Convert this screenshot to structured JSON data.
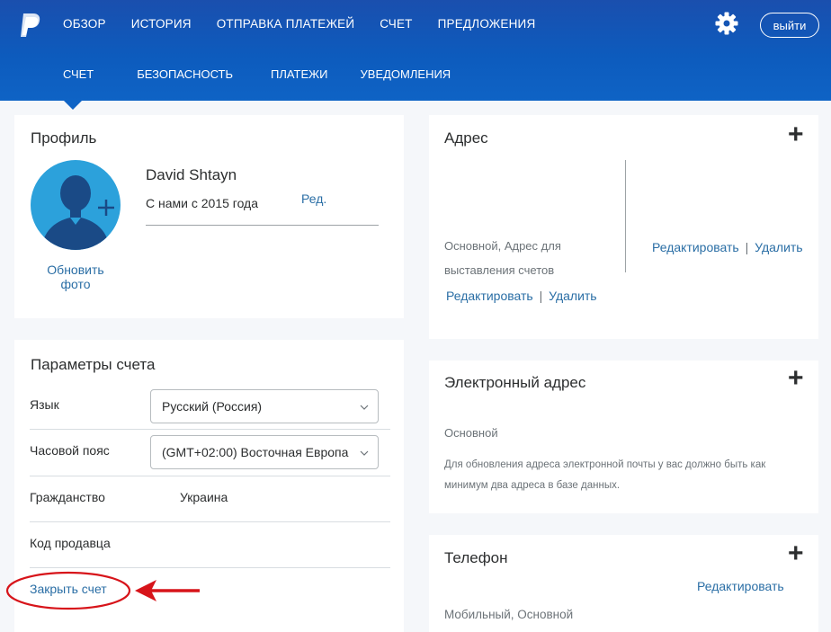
{
  "header": {
    "nav_main": [
      "ОБЗОР",
      "ИСТОРИЯ",
      "ОТПРАВКА ПЛАТЕЖЕЙ",
      "СЧЕТ",
      "ПРЕДЛОЖЕНИЯ"
    ],
    "nav_sub": [
      "СЧЕТ",
      "БЕЗОПАСНОСТЬ",
      "ПЛАТЕЖИ",
      "УВЕДОМЛЕНИЯ"
    ],
    "logout_label": "выйти",
    "icons": [
      "paypal-logo-icon",
      "gear-icon"
    ],
    "brand_color": "#0e63c5"
  },
  "profile": {
    "title": "Профиль",
    "name": "David Shtayn",
    "member_since": "С нами с 2015 года",
    "edit_label": "Ред.",
    "update_photo_line1": "Обновить",
    "update_photo_line2": "фото"
  },
  "account_settings": {
    "title": "Параметры счета",
    "language_label": "Язык",
    "language_value": "Русский (Россия)",
    "timezone_label": "Часовой пояс",
    "timezone_value": "(GMT+02:00) Восточная Европа",
    "citizenship_label": "Гражданство",
    "citizenship_value": "Украина",
    "merchant_code_label": "Код продавца",
    "close_account_label": "Закрыть счет"
  },
  "address": {
    "title": "Адрес",
    "primary_line1": "Основной, Адрес для",
    "primary_line2": "выставления счетов",
    "edit_label": "Редактировать",
    "delete_label": "Удалить",
    "separator": "|"
  },
  "email": {
    "title": "Электронный адрес",
    "primary": "Основной",
    "note_line1": "Для обновления адреса электронной почты у вас должно быть как",
    "note_line2": "минимум два адреса в базе данных."
  },
  "phone": {
    "title": "Телефон",
    "edit_label": "Редактировать",
    "type": "Мобильный, Основной"
  },
  "annotation_color": "#d7141a"
}
